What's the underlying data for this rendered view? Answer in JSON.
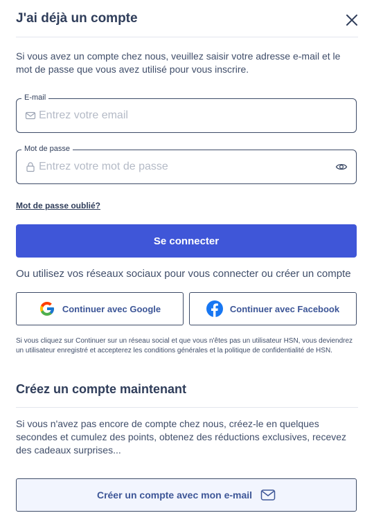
{
  "header": {
    "title": "J'ai déjà un compte",
    "close_icon": "close-icon"
  },
  "intro": "Si vous avez un compte chez nous, veuillez saisir votre adresse e-mail et le mot de passe que vous avez utilisé pour vous inscrire.",
  "email_field": {
    "label": "E-mail",
    "placeholder": "Entrez votre email",
    "value": "",
    "icon": "envelope-icon"
  },
  "password_field": {
    "label": "Mot de passe",
    "placeholder": "Entrez votre mot de passe",
    "value": "",
    "icon": "lock-icon",
    "toggle_icon": "eye-icon"
  },
  "forgot_link": "Mot de passe oublié?",
  "login_button": "Se connecter",
  "social": {
    "text": "Ou utilisez vos réseaux sociaux pour vous connecter ou créer un compte",
    "google_label": "Continuer avec Google",
    "facebook_label": "Continuer avec Facebook",
    "disclaimer": "Si vous cliquez sur Continuer sur un réseau social et que vous n'êtes pas un utilisateur HSN, vous deviendrez un utilisateur enregistré et accepterez les conditions générales et la politique de confidentialité de HSN."
  },
  "create_account": {
    "title": "Créez un compte maintenant",
    "text": "Si vous n'avez pas encore de compte chez nous, créez-le en quelques secondes et cumulez des points, obtenez des réductions exclusives, recevez des cadeaux surprises...",
    "button_label": "Créer un compte avec mon e-mail"
  },
  "colors": {
    "primary": "#3f56d8",
    "text": "#2f3d5a",
    "link": "#3d5697",
    "create_bg": "#f2f5fe"
  }
}
